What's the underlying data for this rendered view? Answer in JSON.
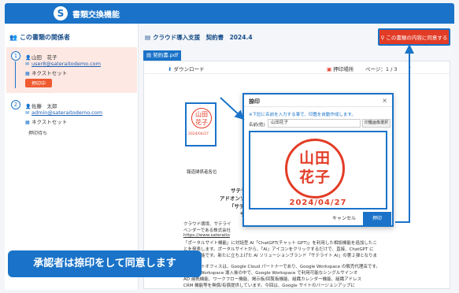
{
  "app": {
    "title": "書類交換機能",
    "logo_letter": "S"
  },
  "sidebar": {
    "heading": "この書類の関係者",
    "approvers": [
      {
        "step": "1",
        "name": "山田　花子",
        "email": "user8@sateraitodemo.com",
        "next": "ネクストセット",
        "status": "押印中"
      },
      {
        "step": "2",
        "name": "佐藤　太郎",
        "email": "admin@sateraitodemo.com",
        "next": "ネクストセット",
        "status": "押印待ち"
      }
    ]
  },
  "main": {
    "breadcrumb": "クラウド導入支援　契約書　2024.4",
    "approve_button": "この書類の内容に同意する",
    "file_tab": "契約書.pdf",
    "toolbar": {
      "download": "ダウンロード",
      "stamp_place": "押印場所",
      "page_label": "ページ：1 / 3"
    }
  },
  "document": {
    "mini_stamp": {
      "line1": "山田",
      "line2": "花子",
      "date": "2024/04/27"
    },
    "lines": {
      "addressee": "報道関係者各位",
      "title1": "サテラ",
      "title2": "アドオンソ",
      "title3": "「サテ",
      "title4": "サ",
      "p1a": "クラウド環境、サテライ",
      "p1b": "ベンダーである株式会社",
      "p1c": "https://www.sateraito",
      "p1d": "「ポータルサイト機能」に対話型 AI「ChatGPT(チャット GPT)」を利用した相談機能を追加したこ",
      "p1e": "とを発表します。ポータルサイトから、「AI」アイコンをクリックするだけで、直接、ChatGPT に",
      "p1f": "質問が可能です。新たに立ち上げた AI ソリューションブランド「サテライト AI」の第２弾となりま",
      "p2a": "サテライトオフィスは、Google Cloud パートナーであり、Google Workspace の販売代理店です。",
      "p2b": "Google Workspace 導入後の中で、Google Workspace で利用可能なシングルサインオ",
      "p2c": "AD 連携機能、ワークフロー機能、掲示板/回覧板機能、組織カレンダー機能、組織アドレス",
      "p2d": "CRM 機能等を無償/有償提供しています。今回は、Google サイトのバージョンアップに"
    }
  },
  "dialog": {
    "title": "捺印",
    "note": "※下記に名前を入力する事で、印鑑を自動作成します。",
    "name_label": "名前(姓)",
    "name_value": "山田花子",
    "search_button": "印鑑画像選択",
    "stamp_line1": "山田",
    "stamp_line2": "花子",
    "stamp_date": "2024/04/27",
    "cancel": "キャンセル",
    "ok": "押印"
  },
  "caption": "承認者は捺印をして同意します",
  "colors": {
    "primary": "#1a73c8",
    "accent_red": "#e23c26",
    "status_orange": "#ef5a2f"
  },
  "icons": [
    "people-icon",
    "user-icon",
    "mail-icon",
    "building-icon",
    "document-icon",
    "download-icon",
    "stamp-icon",
    "chevron-right-icon",
    "close-icon"
  ]
}
